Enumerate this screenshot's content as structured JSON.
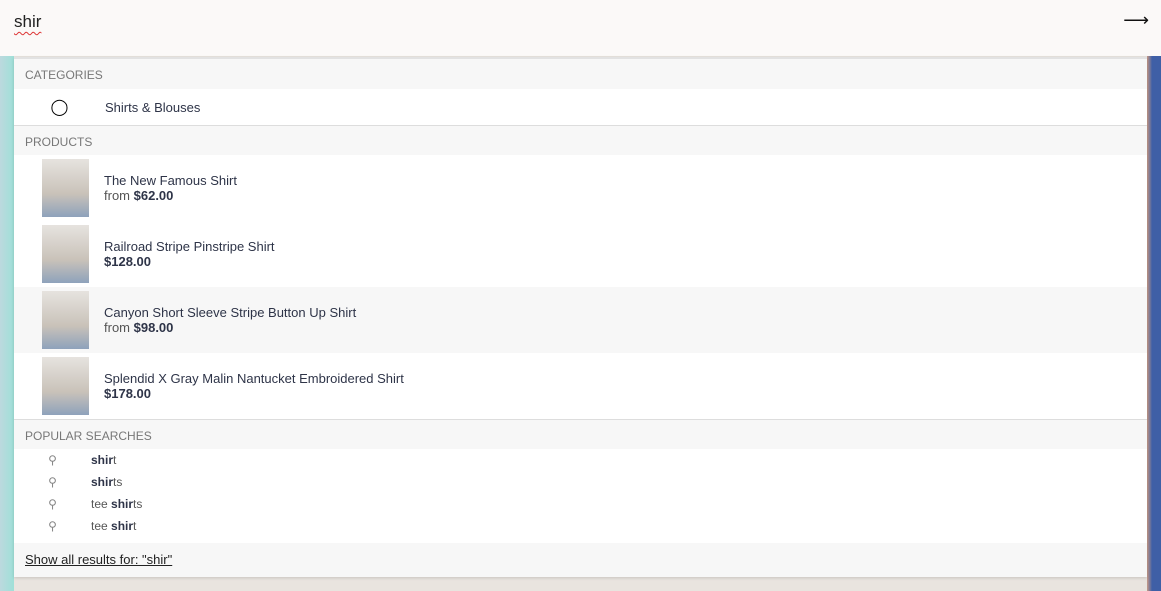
{
  "search": {
    "query": "shir",
    "submit_icon": "arrow-right-icon"
  },
  "categories": {
    "header": "CATEGORIES",
    "items": [
      {
        "label": "Shirts & Blouses",
        "icon": "tag-icon"
      }
    ]
  },
  "products": {
    "header": "PRODUCTS",
    "items": [
      {
        "name": "The New Famous Shirt",
        "from": "from",
        "price": "$62.00"
      },
      {
        "name": "Railroad Stripe Pinstripe Shirt",
        "from": "",
        "price": "$128.00"
      },
      {
        "name": "Canyon Short Sleeve Stripe Button Up Shirt",
        "from": "from",
        "price": "$98.00"
      },
      {
        "name": "Splendid X Gray Malin Nantucket Embroidered Shirt",
        "from": "",
        "price": "$178.00"
      }
    ]
  },
  "popular": {
    "header": "POPULAR SEARCHES",
    "items": [
      {
        "pre": "",
        "bold": "shir",
        "post": "t"
      },
      {
        "pre": "",
        "bold": "shir",
        "post": "ts"
      },
      {
        "pre": "tee ",
        "bold": "shir",
        "post": "ts"
      },
      {
        "pre": "tee ",
        "bold": "shir",
        "post": "t"
      }
    ]
  },
  "footer": {
    "label": "Show all results for: \"shir\""
  }
}
